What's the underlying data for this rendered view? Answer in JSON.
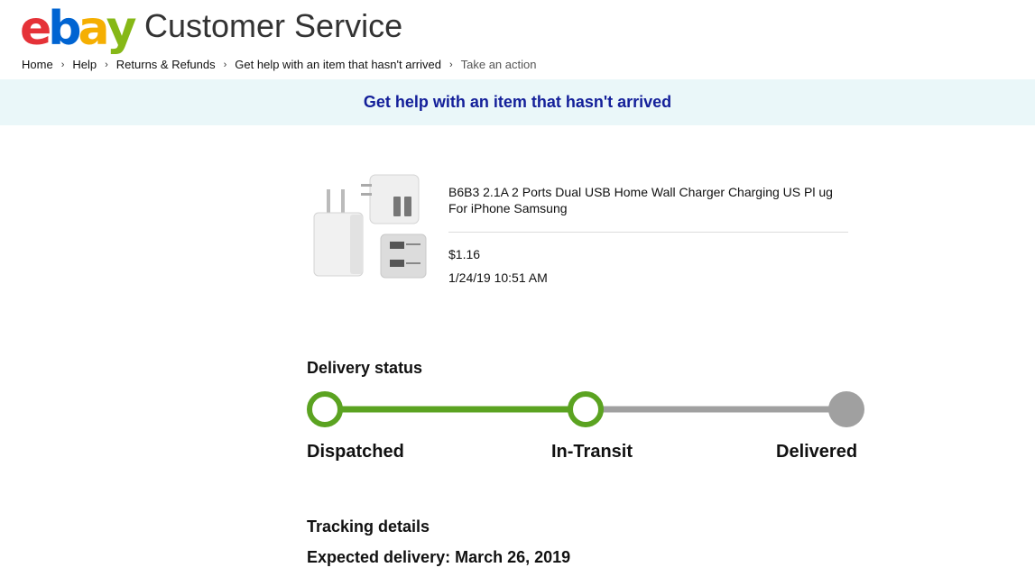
{
  "brand": {
    "logo_letters": [
      {
        "char": "e",
        "color": "#e53238"
      },
      {
        "char": "b",
        "color": "#0064d2"
      },
      {
        "char": "a",
        "color": "#f5af02"
      },
      {
        "char": "y",
        "color": "#86b817"
      }
    ],
    "page_title": "Customer Service"
  },
  "breadcrumb": {
    "items": [
      "Home",
      "Help",
      "Returns & Refunds",
      "Get help with an item that hasn't arrived",
      "Take an action"
    ],
    "separator": "›"
  },
  "banner": {
    "text": "Get help with an item that hasn't arrived",
    "bg_color": "#eaf7f9",
    "text_color": "#14209a"
  },
  "item": {
    "title": "B6B3 2.1A 2 Ports Dual USB Home Wall Charger Charging US Pl ug For iPhone Samsung",
    "price": "$1.16",
    "purchase_date": "1/24/19 10:51 AM",
    "image_icon": "usb-wall-charger-image"
  },
  "delivery": {
    "heading": "Delivery status",
    "progress_fraction": 0.5,
    "steps": [
      {
        "label": "Dispatched",
        "state": "complete"
      },
      {
        "label": "In-Transit",
        "state": "current"
      },
      {
        "label": "Delivered",
        "state": "pending"
      }
    ],
    "colors": {
      "active": "#5ba321",
      "inactive": "#a0a0a0"
    }
  },
  "tracking": {
    "heading": "Tracking details",
    "expected_delivery": "Expected delivery: March 26, 2019"
  }
}
